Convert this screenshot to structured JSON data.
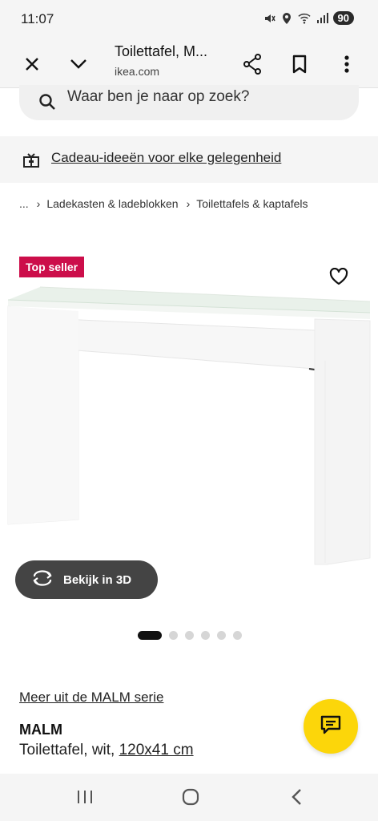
{
  "status_bar": {
    "time": "11:07",
    "battery": "90"
  },
  "browser": {
    "title": "Toilettafel, M...",
    "url": "ikea.com"
  },
  "search": {
    "placeholder": "Waar ben je naar op zoek?"
  },
  "promo": {
    "text": "Cadeau-ideeën voor elke gelegenheid"
  },
  "breadcrumb": {
    "ellipsis": "...",
    "separator": "›",
    "items": [
      "Ladekasten & ladeblokken",
      "Toilettafels & kaptafels"
    ]
  },
  "product": {
    "badge": "Top seller",
    "view_3d_label": "Bekijk in 3D",
    "carousel": {
      "total": 6,
      "active": 1
    },
    "series_link": "Meer uit de MALM serie",
    "name": "MALM",
    "description": "Toilettafel, wit, ",
    "size": "120x41 cm"
  },
  "colors": {
    "badge": "#cc0e4a",
    "chat_button": "#fcd60a",
    "view_3d_button": "#444444"
  },
  "icons": [
    "close-icon",
    "chevron-down-icon",
    "share-icon",
    "bookmark-icon",
    "more-vert-icon",
    "search-icon",
    "gift-icon",
    "heart-icon",
    "rotate-3d-icon",
    "chat-icon",
    "recents-icon",
    "home-icon",
    "back-icon"
  ]
}
